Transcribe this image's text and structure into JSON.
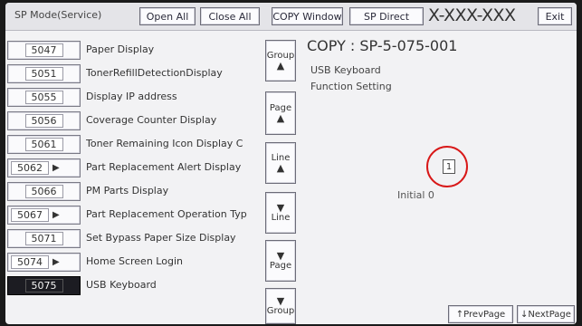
{
  "header": {
    "mode_label": "SP Mode(Service)",
    "open_all": "Open All",
    "close_all": "Close All",
    "copy_window": "COPY Window",
    "sp_direct": "SP Direct",
    "model_code": "X-XXX-XXX",
    "exit": "Exit"
  },
  "sp_list": [
    {
      "code": "5047",
      "label": "Paper Display",
      "has_sub": false,
      "selected": false
    },
    {
      "code": "5051",
      "label": "TonerRefillDetectionDisplay",
      "has_sub": false,
      "selected": false
    },
    {
      "code": "5055",
      "label": "Display IP address",
      "has_sub": false,
      "selected": false
    },
    {
      "code": "5056",
      "label": "Coverage Counter Display",
      "has_sub": false,
      "selected": false
    },
    {
      "code": "5061",
      "label": "Toner Remaining Icon Display C",
      "has_sub": false,
      "selected": false
    },
    {
      "code": "5062",
      "label": "Part Replacement Alert Display",
      "has_sub": true,
      "selected": false
    },
    {
      "code": "5066",
      "label": "PM Parts Display",
      "has_sub": false,
      "selected": false
    },
    {
      "code": "5067",
      "label": "Part Replacement Operation Typ",
      "has_sub": true,
      "selected": false
    },
    {
      "code": "5071",
      "label": "Set Bypass Paper Size Display",
      "has_sub": false,
      "selected": false
    },
    {
      "code": "5074",
      "label": "Home Screen Login",
      "has_sub": true,
      "selected": false
    },
    {
      "code": "5075",
      "label": "USB Keyboard",
      "has_sub": false,
      "selected": true
    }
  ],
  "nav": {
    "group_up": "Group",
    "page_up": "Page",
    "line_up": "Line",
    "line_down": "Line",
    "page_down": "Page",
    "group_down": "Group",
    "up_arrow": "▲",
    "down_arrow": "▼"
  },
  "detail": {
    "sp_title": "COPY : SP-5-075-001",
    "subtitle_1": "USB Keyboard",
    "subtitle_2": "Function Setting",
    "current_value": "1",
    "initial": "Initial 0"
  },
  "pager": {
    "prev": "↑PrevPage",
    "next": "↓NextPage"
  },
  "colors": {
    "highlight_ring": "#d81818",
    "selected_bg": "#1c1c22"
  }
}
